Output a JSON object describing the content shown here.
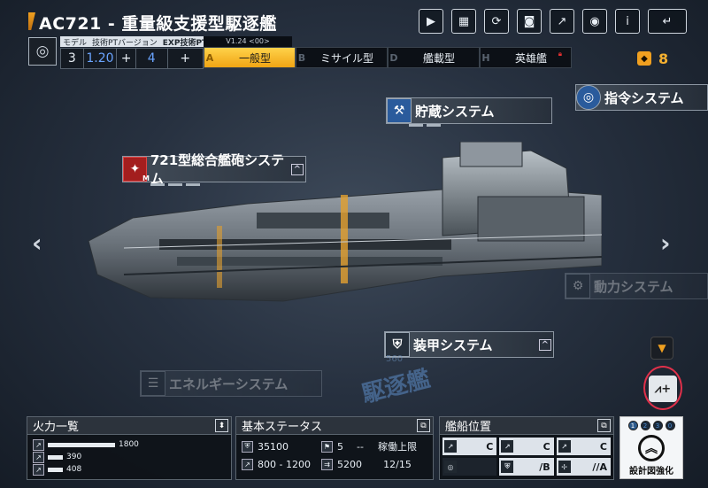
{
  "header": {
    "title": "AC721 - 重量級支援型駆逐艦",
    "icons": [
      "video-icon",
      "gallery-icon",
      "refresh-icon",
      "camera-icon",
      "share-icon",
      "view-icon",
      "info-icon",
      "return-icon"
    ]
  },
  "info": {
    "model_label": "モデル",
    "tech_label": "技術PTバージョン",
    "exp_label": "EXP技術PT",
    "model_value": "3",
    "tech_value": "1.20",
    "exp_value": "4",
    "version": "V1.24 <00>"
  },
  "tabs": [
    {
      "letter": "A",
      "label": "一般型",
      "active": true
    },
    {
      "letter": "B",
      "label": "ミサイル型",
      "active": false
    },
    {
      "letter": "D",
      "label": "艦載型",
      "active": false
    },
    {
      "letter": "H",
      "label": "英雄艦",
      "active": false,
      "locked": true
    }
  ],
  "currency": {
    "value": "8",
    "color": "#f5b030"
  },
  "systems": {
    "storage": "貯蔵システム",
    "command": "指令システム",
    "cannon": "721型総合艦砲システム",
    "power": "動力システム",
    "armor": "装甲システム",
    "energy": "エネルギーシステム",
    "cannon_badge": "M"
  },
  "watermark": {
    "class_name": "駆逐艦",
    "number": "560"
  },
  "firepower": {
    "title": "火力一覧",
    "rows": [
      {
        "value": "1800",
        "fraction": 0.58
      },
      {
        "value": "390",
        "fraction": 0.13
      },
      {
        "value": "408",
        "fraction": 0.13
      }
    ]
  },
  "basic_status": {
    "title": "基本ステータス",
    "hp": "35100",
    "armor": "5",
    "armor_extra": "--",
    "range": "800 - 1200",
    "speed": "5200",
    "operation_label": "稼働上限",
    "operation_value": "12/15"
  },
  "slots": {
    "title": "艦船位置",
    "cells": [
      "C",
      "C",
      "C",
      "",
      "/B",
      "//A"
    ]
  },
  "enhance": {
    "label": "設計図強化",
    "dots": [
      "1",
      "2",
      "3",
      "0"
    ]
  }
}
